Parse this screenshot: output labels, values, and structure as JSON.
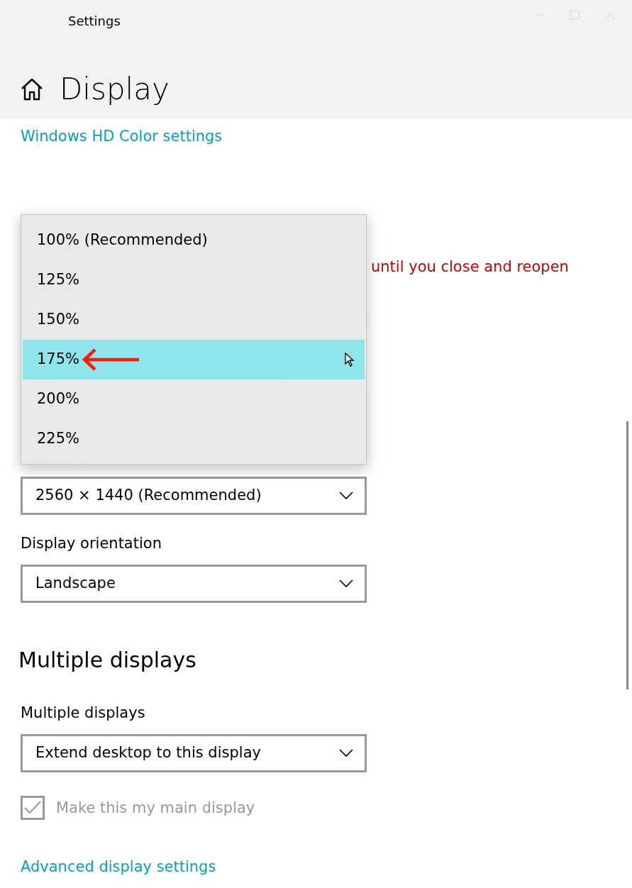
{
  "window": {
    "title": "Settings"
  },
  "page": {
    "title": "Display"
  },
  "hd_color_link": "Windows HD Color settings",
  "scale_section": {
    "warning_fragment": "until you close and reopen",
    "scale_menu": [
      {
        "label": "100% (Recommended)",
        "selected": false
      },
      {
        "label": "125%",
        "selected": false
      },
      {
        "label": "150%",
        "selected": false
      },
      {
        "label": "175%",
        "selected": true
      },
      {
        "label": "200%",
        "selected": false
      },
      {
        "label": "225%",
        "selected": false
      }
    ],
    "resolution": {
      "value": "2560 × 1440 (Recommended)"
    },
    "orientation": {
      "label": "Display orientation",
      "value": "Landscape"
    }
  },
  "multiple_section": {
    "heading": "Multiple displays",
    "label": "Multiple displays",
    "value": "Extend desktop to this display",
    "main_display": {
      "label": "Make this my main display",
      "checked": true,
      "disabled": true
    }
  },
  "advanced_link": "Advanced display settings"
}
